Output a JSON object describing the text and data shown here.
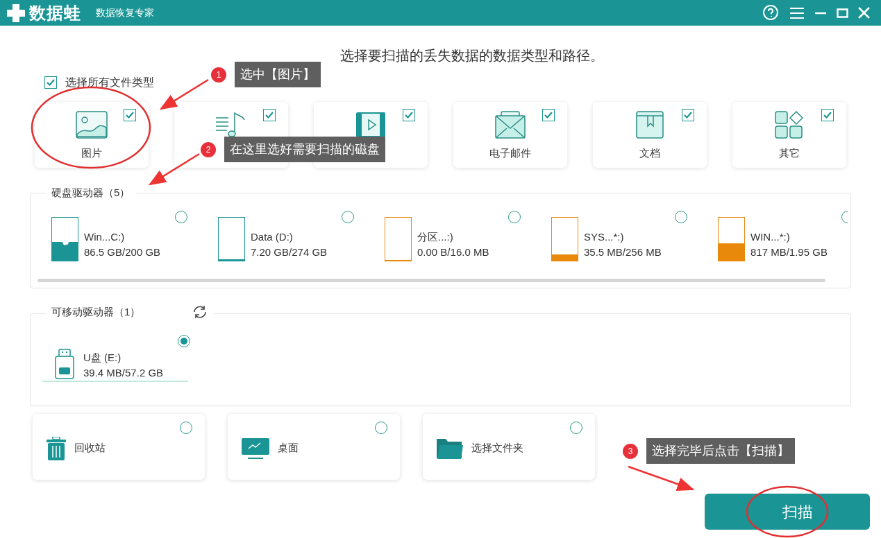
{
  "window": {
    "logo": "数据蛙",
    "subtitle": "数据恢复专家"
  },
  "heading": "选择要扫描的丢失数据的数据类型和路径。",
  "select_all": {
    "label": "选择所有文件类型",
    "checked": true
  },
  "file_types": [
    {
      "kind": "image",
      "label": "图片",
      "checked": true
    },
    {
      "kind": "audio",
      "checked": true
    },
    {
      "kind": "video",
      "checked": true
    },
    {
      "kind": "email",
      "label": "电子邮件",
      "checked": true
    },
    {
      "kind": "document",
      "label": "文档",
      "checked": true
    },
    {
      "kind": "other",
      "label": "其它",
      "checked": true
    }
  ],
  "hard_drives": {
    "title": "硬盘驱动器（5）",
    "items": [
      {
        "name": "Win...C:)",
        "usage": "86.5 GB/200 GB",
        "level": 0.43,
        "color": "#1a9494",
        "selected": false,
        "badge": true
      },
      {
        "name": "Data (D:)",
        "usage": "7.20 GB/274 GB",
        "level": 0.03,
        "color": "#1a9494",
        "selected": false
      },
      {
        "name": "分区...:)",
        "usage": "0.00  B/16.0 MB",
        "level": 0,
        "color": "#e8890c",
        "selected": false
      },
      {
        "name": "SYS...*:)",
        "usage": "35.5 MB/256 MB",
        "level": 0.14,
        "color": "#e8890c",
        "selected": false
      },
      {
        "name": "WIN...*:)",
        "usage": "817 MB/1.95 GB",
        "level": 0.41,
        "color": "#e8890c",
        "selected": false
      }
    ]
  },
  "removable_drives": {
    "title": "可移动驱动器（1）",
    "items": [
      {
        "name": "U盘 (E:)",
        "usage": "39.4 MB/57.2 GB",
        "selected": true
      }
    ]
  },
  "locations": [
    {
      "kind": "recycle",
      "label": "回收站",
      "selected": false
    },
    {
      "kind": "desktop",
      "label": "桌面",
      "selected": false
    },
    {
      "kind": "folder",
      "label": "选择文件夹",
      "selected": false
    }
  ],
  "scan_button": "扫描",
  "annotations": [
    {
      "number": "1",
      "text": "选中【图片】"
    },
    {
      "number": "2",
      "text": "在这里选好需要扫描的磁盘"
    },
    {
      "number": "3",
      "text": "选择完毕后点击【扫描】"
    }
  ]
}
